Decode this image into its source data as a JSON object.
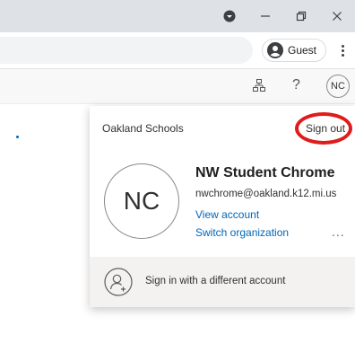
{
  "browser": {
    "profile_chip": {
      "label": "Guest",
      "icon": "account-circle-icon"
    },
    "window_controls": [
      "minimize-icon",
      "restore-icon",
      "close-icon"
    ]
  },
  "app_bar": {
    "icons": [
      "org-chart-icon",
      "help-icon"
    ],
    "help_label": "?",
    "avatar_initials": "NC"
  },
  "account_panel": {
    "organization": "Oakland Schools",
    "sign_out_label": "Sign out",
    "avatar_initials": "NC",
    "user_name": "NW Student Chrome",
    "user_email": "nwchrome@oakland.k12.mi.us",
    "view_account_label": "View account",
    "switch_org_label": "Switch organization",
    "more_label": "...",
    "footer_label": "Sign in with a different account"
  },
  "colors": {
    "highlight_circle": "#e01b1b",
    "link": "#0067b8",
    "titlebar": "#dee1e6"
  }
}
